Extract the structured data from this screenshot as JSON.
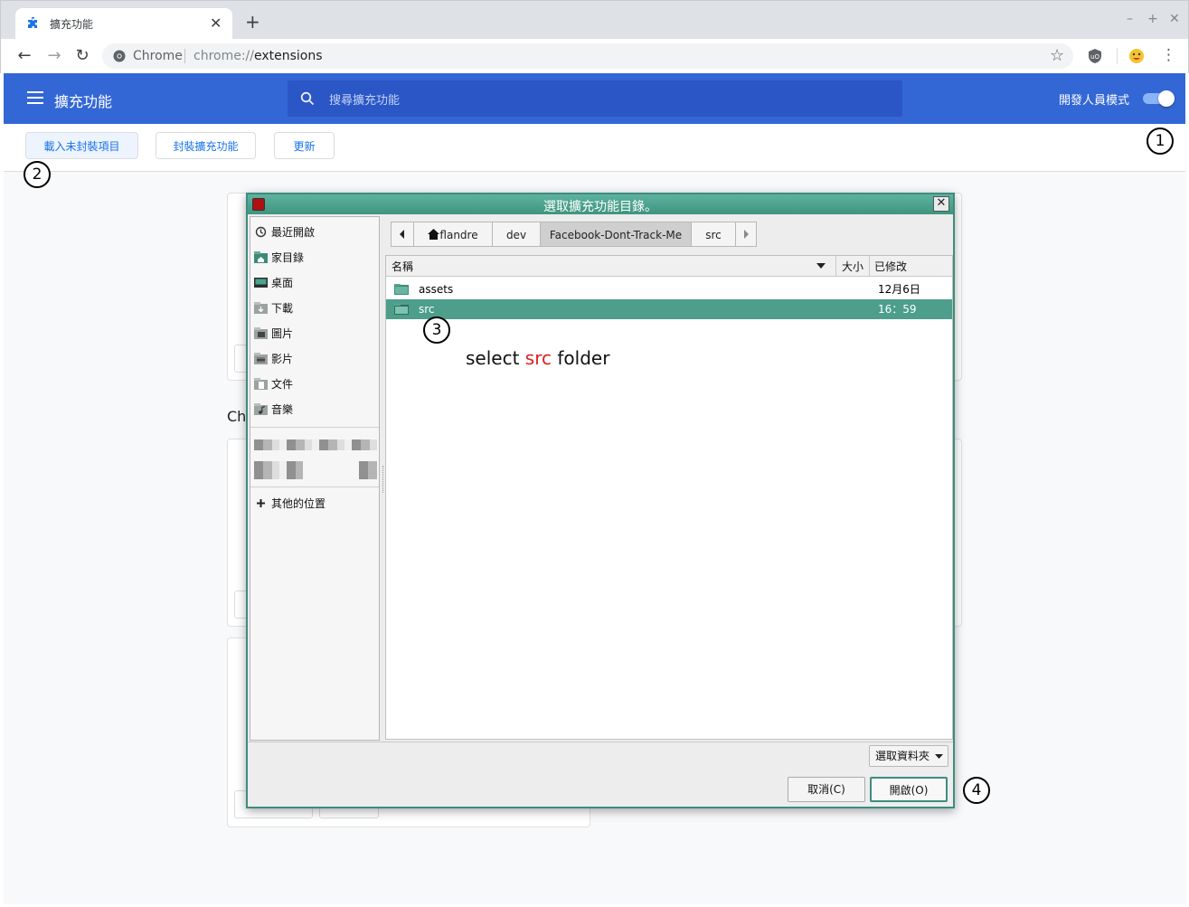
{
  "browser": {
    "tab_title": "擴充功能",
    "new_tab": "+",
    "tab_close": "✕",
    "window_controls": {
      "minimize": "–",
      "maximize": "+",
      "close": "✕"
    },
    "omnibox": {
      "scheme_label": "Chrome",
      "url_prefix": "chrome://",
      "url_path": "extensions"
    },
    "nav": {
      "back": "←",
      "forward": "→",
      "reload": "↻"
    },
    "star": "☆",
    "menu": "⋮"
  },
  "extensions_page": {
    "title": "擴充功能",
    "search_placeholder": "搜尋擴充功能",
    "dev_mode_label": "開發人員模式",
    "dev_mode_on": true,
    "actions": [
      "載入未封裝項目",
      "封裝擴充功能",
      "更新"
    ],
    "partial_heading": "Ch"
  },
  "dialog": {
    "title": "選取擴充功能目錄。",
    "close": "✕",
    "places": [
      {
        "label": "最近開啟",
        "icon": "recent-icon"
      },
      {
        "label": "家目錄",
        "icon": "home-folder-icon"
      },
      {
        "label": "桌面",
        "icon": "desktop-icon"
      },
      {
        "label": "下載",
        "icon": "downloads-folder-icon"
      },
      {
        "label": "圖片",
        "icon": "pictures-folder-icon"
      },
      {
        "label": "影片",
        "icon": "videos-folder-icon"
      },
      {
        "label": "文件",
        "icon": "documents-folder-icon"
      },
      {
        "label": "音樂",
        "icon": "music-folder-icon"
      }
    ],
    "other_locations": "其他的位置",
    "path": [
      "flandre",
      "dev",
      "Facebook-Dont-Track-Me",
      "src"
    ],
    "path_active": "Facebook-Dont-Track-Me",
    "columns": {
      "name": "名稱",
      "size": "大小",
      "modified": "已修改"
    },
    "files": [
      {
        "name": "assets",
        "modified": "12月6日",
        "selected": false
      },
      {
        "name": "src",
        "modified": "16：59",
        "selected": true
      }
    ],
    "type_button": "選取資料夾",
    "cancel_button": "取消(C)",
    "open_button": "開啟(O)"
  },
  "annotations": {
    "markers": [
      "1",
      "2",
      "3",
      "4"
    ],
    "note": {
      "before": "select",
      "highlight": "src",
      "after": "folder"
    }
  },
  "colors": {
    "header_blue": "#3367d6",
    "dialog_teal": "#3d8d7d",
    "selection": "#4d9e8a",
    "note_highlight": "#e02020"
  }
}
